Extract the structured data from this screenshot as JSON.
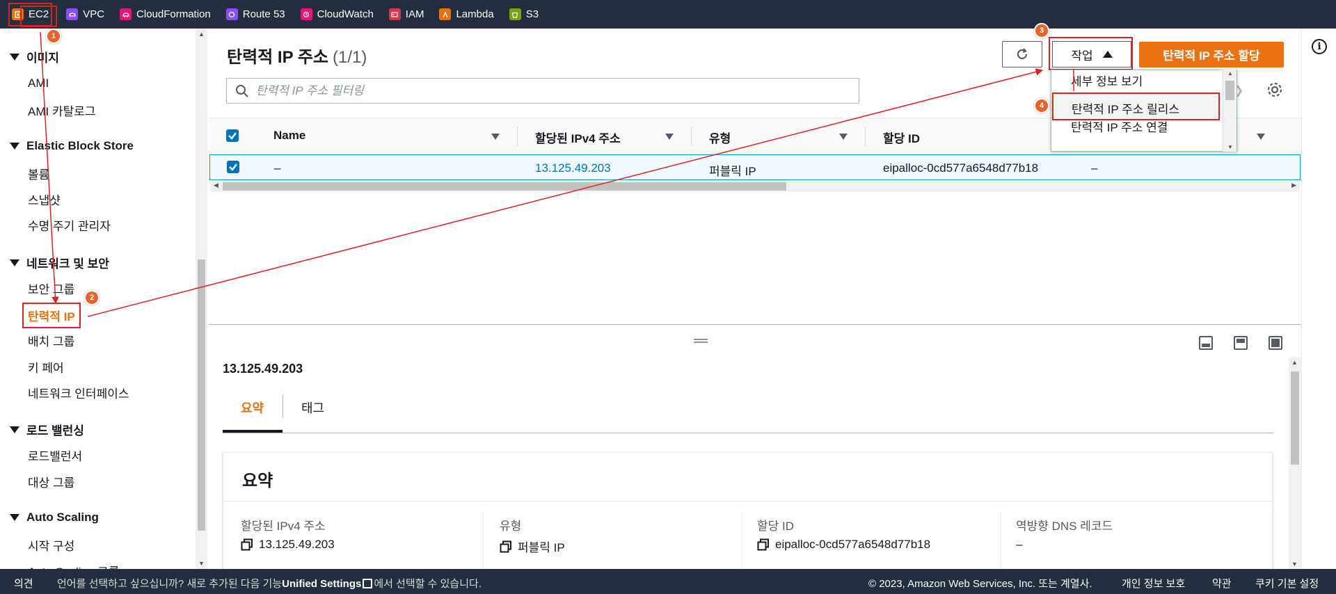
{
  "topnav": {
    "services": [
      {
        "label": "EC2",
        "icon": "ec2-icon",
        "color": "#ed7100"
      },
      {
        "label": "VPC",
        "icon": "vpc-icon",
        "color": "#8c4fff"
      },
      {
        "label": "CloudFormation",
        "icon": "cloudformation-icon",
        "color": "#e7157b"
      },
      {
        "label": "Route 53",
        "icon": "route53-icon",
        "color": "#8c4fff"
      },
      {
        "label": "CloudWatch",
        "icon": "cloudwatch-icon",
        "color": "#e7157b"
      },
      {
        "label": "IAM",
        "icon": "iam-icon",
        "color": "#dd344c"
      },
      {
        "label": "Lambda",
        "icon": "lambda-icon",
        "color": "#ed7100"
      },
      {
        "label": "S3",
        "icon": "s3-icon",
        "color": "#7aa116"
      }
    ]
  },
  "sidebar": {
    "sections": [
      {
        "title": "이미지",
        "items": [
          "AMI",
          "AMI 카탈로그"
        ]
      },
      {
        "title": "Elastic Block Store",
        "items": [
          "볼륨",
          "스냅샷",
          "수명 주기 관리자"
        ]
      },
      {
        "title": "네트워크 및 보안",
        "items": [
          "보안 그룹",
          "탄력적 IP",
          "배치 그룹",
          "키 페어",
          "네트워크 인터페이스"
        ]
      },
      {
        "title": "로드 밸런싱",
        "items": [
          "로드밸런서",
          "대상 그룹"
        ]
      },
      {
        "title": "Auto Scaling",
        "items": [
          "시작 구성",
          "Auto Scaling 그룹"
        ]
      }
    ],
    "active_item": "탄력적 IP"
  },
  "main": {
    "title": "탄력적 IP 주소",
    "count": "(1/1)",
    "action_label": "작업",
    "allocate_label": "탄력적 IP 주소 할당",
    "search_placeholder": "탄력적 IP 주소 필터링"
  },
  "table": {
    "headers": [
      "Name",
      "할당된 IPv4 주소",
      "유형",
      "할당 ID"
    ],
    "row": {
      "name": "–",
      "ipv4": "13.125.49.203",
      "type": "퍼블릭 IP",
      "allocation_id": "eipalloc-0cd577a6548d77b18",
      "extra": "–"
    }
  },
  "menu": {
    "items": [
      "세부 정보 보기",
      "탄력적 IP 주소 릴리스",
      "탄력적 IP 주소 연결"
    ]
  },
  "detail": {
    "title": "13.125.49.203",
    "tabs": [
      "요약",
      "태그"
    ],
    "summary_heading": "요약",
    "fields": [
      {
        "label": "할당된 IPv4 주소",
        "value": "13.125.49.203"
      },
      {
        "label": "유형",
        "value": "퍼블릭 IP"
      },
      {
        "label": "할당 ID",
        "value": "eipalloc-0cd577a6548d77b18"
      },
      {
        "label": "역방향 DNS 레코드",
        "value": "–"
      }
    ]
  },
  "footer": {
    "feedback": "의견",
    "lang_prefix": "언어를 선택하고 싶으십니까? 새로 추가된 다음 기능",
    "unified_settings": "Unified Settings",
    "lang_suffix": "에서 선택할 수 있습니다.",
    "copyright": "© 2023, Amazon Web Services, Inc. 또는 계열사.",
    "privacy": "개인 정보 보호",
    "terms": "약관",
    "cookies": "쿠키 기본 설정"
  },
  "annotations": [
    "1",
    "2",
    "3",
    "4"
  ],
  "colors": {
    "accent": "#ec7211",
    "annotation_red": "#e02020",
    "link": "#0073bb",
    "nav_bg": "#232f3e"
  }
}
